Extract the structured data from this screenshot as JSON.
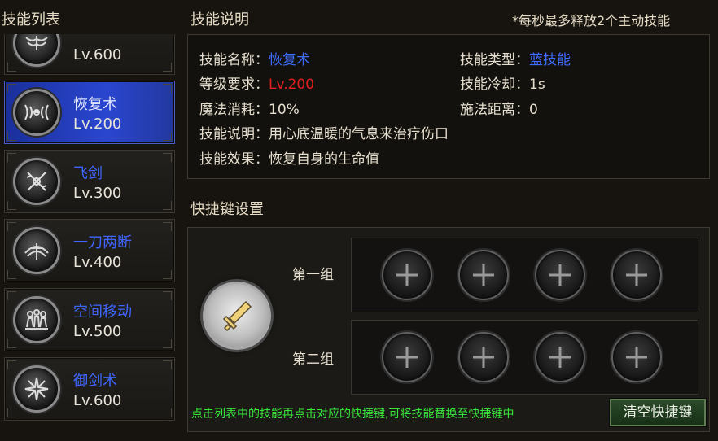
{
  "skill_list": {
    "title": "技能列表",
    "items": [
      {
        "name": "",
        "level": "Lv.600",
        "icon": "angel-wings-icon"
      },
      {
        "name": "恢复术",
        "level": "Lv.200",
        "icon": "healing-wings-icon",
        "active": true
      },
      {
        "name": "飞剑",
        "level": "Lv.300",
        "icon": "flying-sword-icon"
      },
      {
        "name": "一刀两断",
        "level": "Lv.400",
        "icon": "blade-slash-icon"
      },
      {
        "name": "空间移动",
        "level": "Lv.500",
        "icon": "teleport-icon"
      },
      {
        "name": "御剑术",
        "level": "Lv.600",
        "icon": "sword-vortex-icon"
      }
    ]
  },
  "description": {
    "title": "技能说明",
    "note": "*每秒最多释放2个主动技能",
    "name_label": "技能名称：",
    "name_value": "恢复术",
    "type_label": "技能类型：",
    "type_value": "蓝技能",
    "req_label": "等级要求：",
    "req_value": "Lv.200",
    "cooldown_label": "技能冷却：",
    "cooldown_value": "1s",
    "mana_label": "魔法消耗：",
    "mana_value": "10%",
    "range_label": "施法距离：",
    "range_value": "0",
    "desc_label": "技能说明：",
    "desc_value": "用心底温暖的气息来治疗伤口",
    "effect_label": "技能效果：",
    "effect_value": "恢复自身的生命值"
  },
  "hotkeys": {
    "title": "快捷键设置",
    "group1_label": "第一组",
    "group2_label": "第二组",
    "selected_skill_icon": "sword-icon",
    "hint": "点击列表中的技能再点击对应的快捷键,可将技能替换至快捷键中",
    "clear_button": "清空快捷键"
  },
  "colors": {
    "blue_text": "#3f6cff",
    "red_text": "#e02020",
    "hint_green": "#39e53a",
    "active_blue": "#2a46d0"
  }
}
